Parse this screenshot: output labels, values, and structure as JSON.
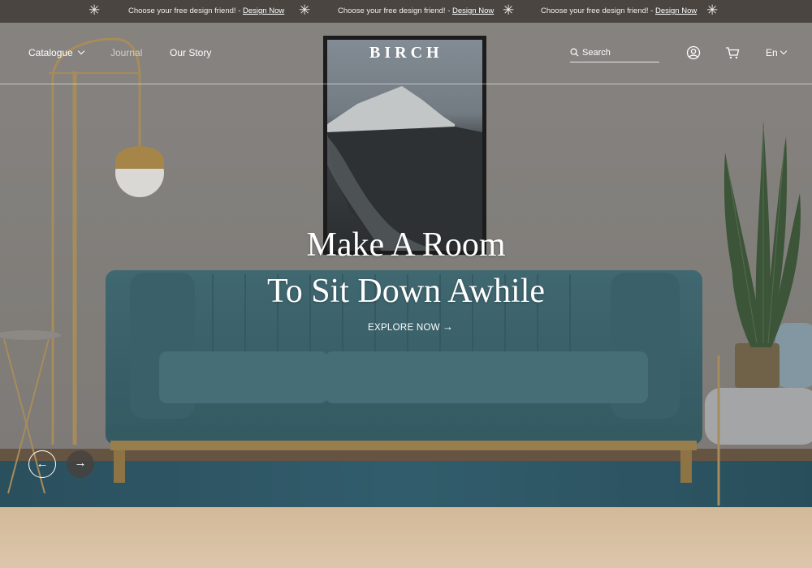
{
  "announcement": {
    "items": [
      {
        "text": "Choose your free design friend! - ",
        "link": "Design Now"
      },
      {
        "text": "Choose your free design friend! - ",
        "link": "Design Now"
      },
      {
        "text": "Choose your free design friend! - ",
        "link": "Design Now"
      }
    ],
    "separator_glyph": "✳"
  },
  "nav": {
    "catalogue": "Catalogue",
    "journal": "Journal",
    "our_story": "Our Story",
    "logo": "BIRCH",
    "search_placeholder": "Search",
    "language": "En"
  },
  "hero": {
    "headline_line1": "Make A Room",
    "headline_line2": "To Sit Down Awhile",
    "cta": "EXPLORE NOW",
    "cta_arrow": "→",
    "prev_glyph": "←",
    "next_glyph": "→"
  },
  "icons": {
    "search": "search-icon",
    "account": "user-icon",
    "cart": "cart-icon",
    "language_chevron": "chevron-down-icon",
    "catalogue_chevron": "chevron-down-icon"
  },
  "colors": {
    "announcement_bg": "#4a4541",
    "sofa": "#3e6a75",
    "wall": "#8e8a87",
    "rug": "#2e5c6c",
    "bottom_band": "#d8c1a3"
  }
}
